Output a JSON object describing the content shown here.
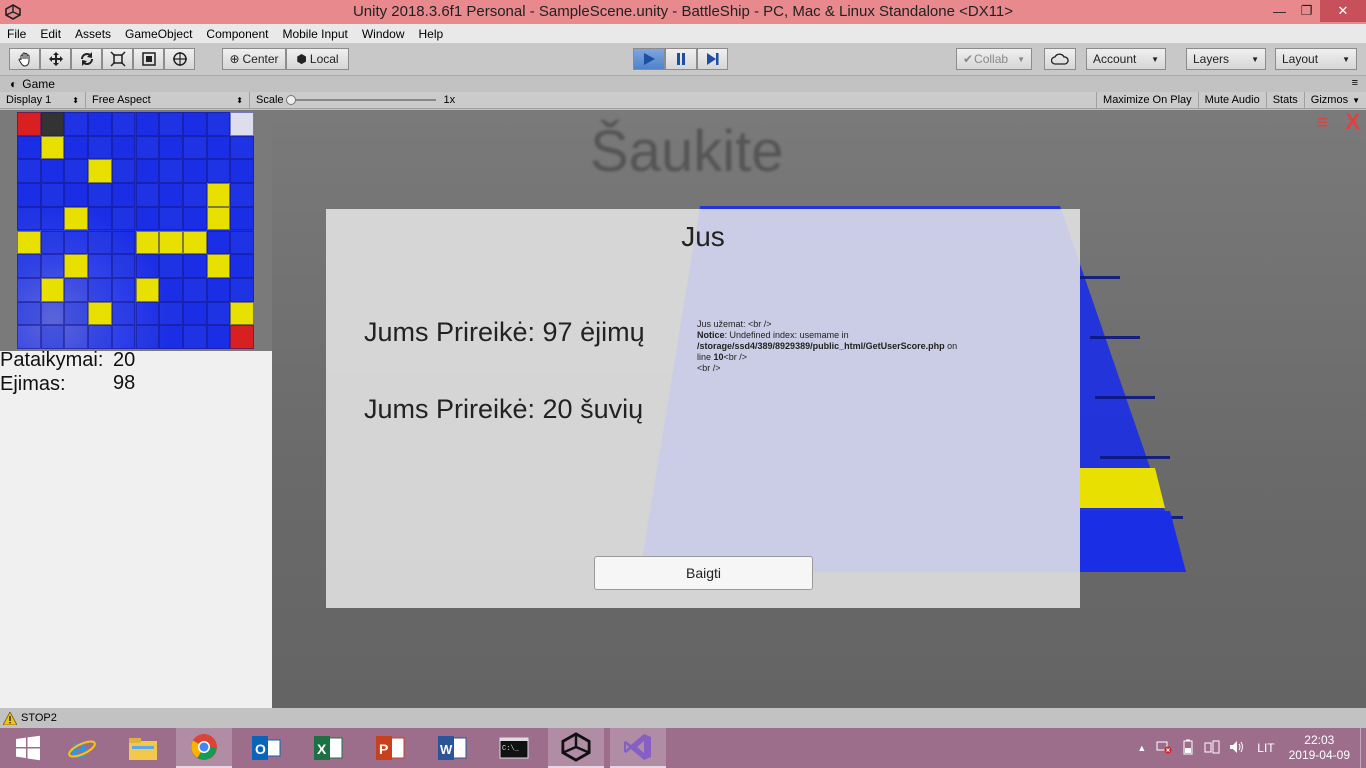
{
  "window": {
    "title": "Unity 2018.3.6f1 Personal - SampleScene.unity - BattleShip - PC, Mac & Linux Standalone <DX11>"
  },
  "menu": [
    "File",
    "Edit",
    "Assets",
    "GameObject",
    "Component",
    "Mobile Input",
    "Window",
    "Help"
  ],
  "toolbar": {
    "center_label": "Center",
    "local_label": "Local",
    "collab_label": "Collab",
    "account_label": "Account",
    "layers_label": "Layers",
    "layout_label": "Layout"
  },
  "game_tab": {
    "label": "Game",
    "display": "Display 1",
    "aspect": "Free Aspect",
    "scale_label": "Scale",
    "scale_value": "1x",
    "scale_fraction": 0,
    "maximize_on_play": "Maximize On Play",
    "mute_audio": "Mute Audio",
    "stats": "Stats",
    "gizmos": "Gizmos"
  },
  "game": {
    "heading": "Šaukite",
    "menu_icon": "≡",
    "close_glyph": "X",
    "stats": {
      "hits_label": "Pataikymai:",
      "hits_value": "20",
      "moves_label": "Ejimas:",
      "moves_value": "98"
    },
    "dialog": {
      "title": "Jus",
      "line1": "Jums Prireikė: 97 ėjimų",
      "line2": "Jums Prireikė: 20 šuvių",
      "error": {
        "line1": "Jus užemat: <br />",
        "notice_label": "Notice",
        "notice_text": ":  Undefined index: usemame in",
        "path": "/storage/ssd4/389/8929389/public_html/GetUserScore.php",
        "on": " on",
        "line_label": "line ",
        "line_num": "10",
        "line_tail": "<br />",
        "br": "<br />"
      },
      "button": "Baigti"
    }
  },
  "status": {
    "message": "STOP2"
  },
  "taskbar": {
    "language": "LIT",
    "time": "22:03",
    "date": "2019-04-09",
    "apps": [
      "windows-start",
      "internet-explorer",
      "file-explorer",
      "chrome",
      "outlook",
      "excel",
      "powerpoint",
      "word",
      "command-prompt",
      "unity",
      "visual-studio"
    ]
  },
  "colors": {
    "titlebar": "#e8898d",
    "taskbar": "#9c6e8c",
    "board_blue": "#1a2ee6",
    "board_yellow": "#e8e000",
    "hit_red": "#d82020",
    "play_active": "#4f82cc"
  }
}
